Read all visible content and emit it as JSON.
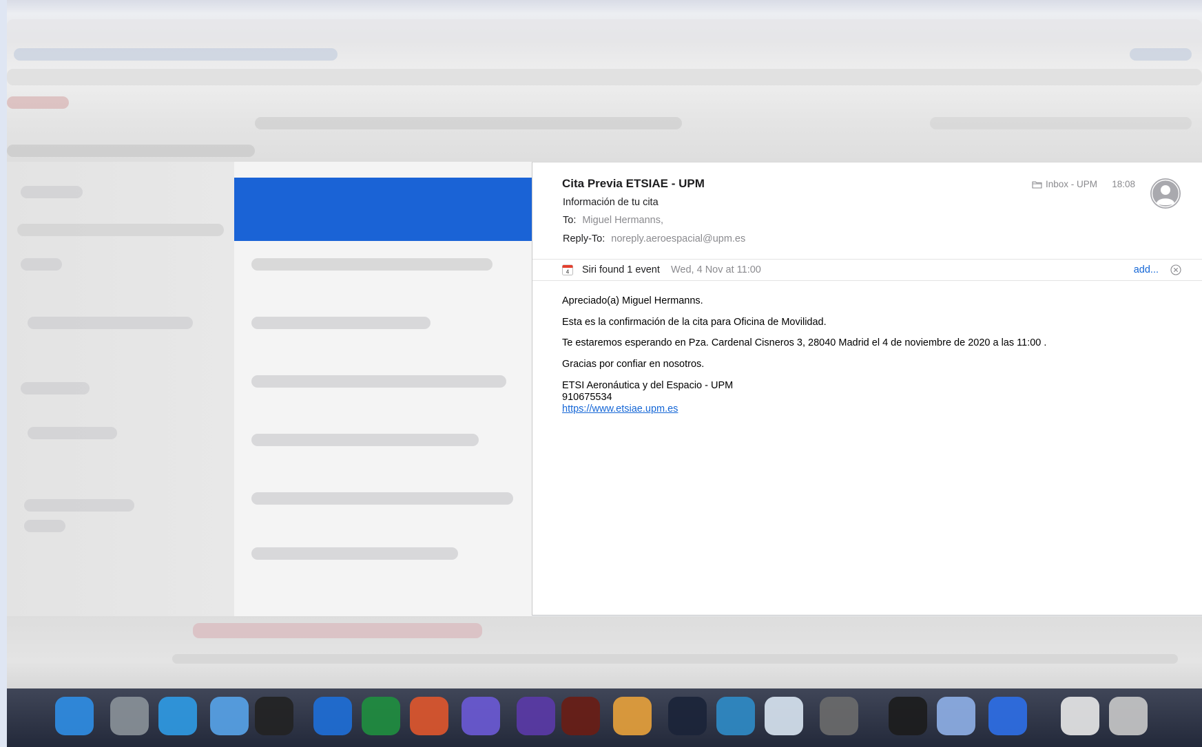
{
  "message": {
    "sender": "Cita Previa ETSIAE - UPM",
    "subject": "Información de tu cita",
    "to_label": "To:",
    "to_value": "Miguel Hermanns,",
    "reply_to_label": "Reply-To:",
    "reply_to_value": "noreply.aeroespacial@upm.es",
    "mailbox": "Inbox - UPM",
    "time": "18:08"
  },
  "siri": {
    "found": "Siri found 1 event",
    "date": "Wed, 4 Nov at 11:00",
    "add": "add...",
    "calendar_day": "4"
  },
  "body": {
    "greeting": "Apreciado(a) Miguel Hermanns.",
    "line1": "Esta es la confirmación de la cita para Oficina de Movilidad.",
    "line2": "Te estaremos esperando en Pza. Cardenal Cisneros 3, 28040 Madrid el 4 de noviembre de 2020 a las 11:00 .",
    "line3": "Gracias por confiar en nosotros.",
    "signature_org": "ETSI Aeronáutica y del Espacio - UPM",
    "signature_phone": "910675534",
    "signature_link": "https://www.etsiae.upm.es"
  },
  "icons": {
    "folder": "folder-icon",
    "avatar": "person-avatar-icon",
    "calendar": "calendar-icon",
    "close": "close-circle-icon"
  },
  "colors": {
    "accent": "#1466d6",
    "selection": "#1a63d6",
    "secondary_text": "#8a8a8e"
  }
}
